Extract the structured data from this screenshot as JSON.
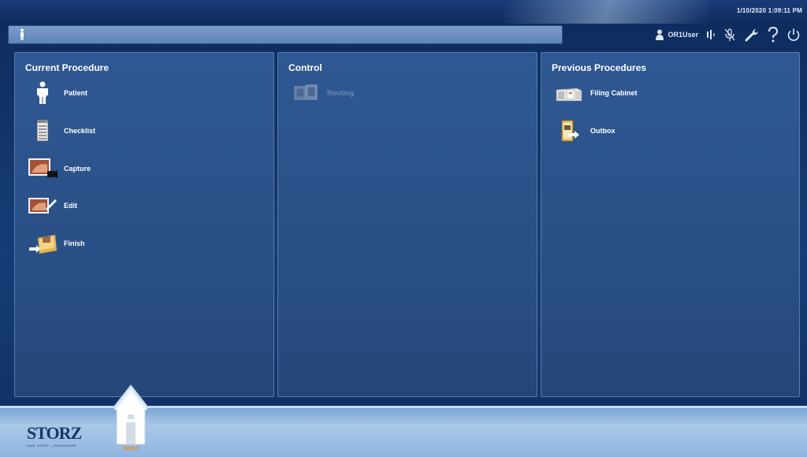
{
  "header": {
    "datetime": "1/10/2020  1:09:11 PM",
    "user": "OR1User"
  },
  "panels": {
    "current": {
      "title": "Current Procedure",
      "items": [
        {
          "label": "Patient",
          "icon": "patient-icon"
        },
        {
          "label": "Checklist",
          "icon": "checklist-icon"
        },
        {
          "label": "Capture",
          "icon": "capture-icon"
        },
        {
          "label": "Edit",
          "icon": "edit-icon"
        },
        {
          "label": "Finish",
          "icon": "finish-icon"
        }
      ]
    },
    "control": {
      "title": "Control",
      "items": [
        {
          "label": "Routing",
          "icon": "routing-icon",
          "enabled": false
        }
      ]
    },
    "previous": {
      "title": "Previous Procedures",
      "items": [
        {
          "label": "Filing Cabinet",
          "icon": "filing-cabinet-icon"
        },
        {
          "label": "Outbox",
          "icon": "outbox-icon"
        }
      ]
    }
  },
  "footer": {
    "brand": "STORZ",
    "brand_sub": "KARL STORZ — ENDOSKOPE",
    "home_label": "Home"
  },
  "colors": {
    "accent": "#f28a1a",
    "panel": "#2c5188",
    "background": "#0f2f63"
  }
}
